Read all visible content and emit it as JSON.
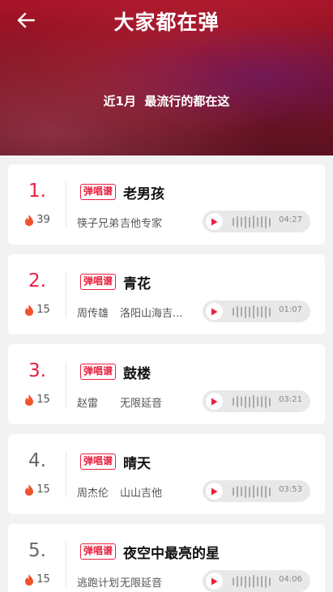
{
  "header": {
    "title": "大家都在弹",
    "subtitle": "近1月  最流行的都在这"
  },
  "colors": {
    "accent": "#e8203f",
    "rank_gray": "#666666"
  },
  "tag_label": "弹唱谱",
  "songs": [
    {
      "rank": "1.",
      "heat": "39",
      "title": "老男孩",
      "artist": "筷子兄弟",
      "uploader": "吉他专家",
      "duration": "04:27"
    },
    {
      "rank": "2.",
      "heat": "15",
      "title": "青花",
      "artist": "周传雄",
      "uploader": "洛阳山海吉...",
      "duration": "01:07"
    },
    {
      "rank": "3.",
      "heat": "15",
      "title": "鼓楼",
      "artist": "赵雷",
      "uploader": "无限延音",
      "duration": "03:21"
    },
    {
      "rank": "4.",
      "heat": "15",
      "title": "晴天",
      "artist": "周杰伦",
      "uploader": "山山吉他",
      "duration": "03:53"
    },
    {
      "rank": "5.",
      "heat": "15",
      "title": "夜空中最亮的星",
      "artist": "逃跑计划",
      "uploader": "无限延音",
      "duration": "04:06"
    }
  ]
}
